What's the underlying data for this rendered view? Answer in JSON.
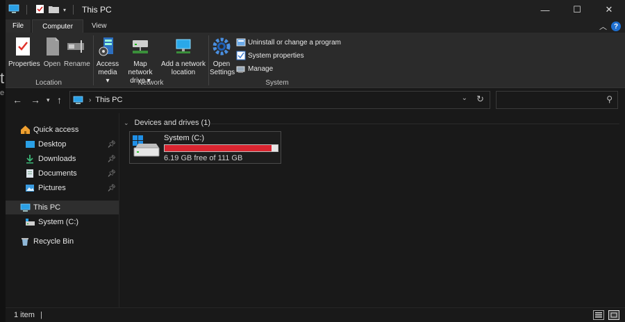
{
  "window": {
    "title": "This PC"
  },
  "controls": {
    "minimize": "—",
    "maximize": "☐",
    "close": "✕"
  },
  "tabs": {
    "file": "File",
    "computer": "Computer",
    "view": "View"
  },
  "ribbon": {
    "location": {
      "label": "Location",
      "properties": "Properties",
      "open": "Open",
      "rename": "Rename"
    },
    "network": {
      "label": "Network",
      "access_media": [
        "Access",
        "media ▾"
      ],
      "map_drive": [
        "Map network",
        "drive ▾"
      ],
      "add_location": [
        "Add a network",
        "location"
      ]
    },
    "system": {
      "label": "System",
      "open_settings": [
        "Open",
        "Settings"
      ],
      "uninstall": "Uninstall or change a program",
      "system_properties": "System properties",
      "manage": "Manage"
    }
  },
  "address": {
    "crumb": "This PC",
    "search_placeholder": ""
  },
  "nav": {
    "quick_access": "Quick access",
    "desktop": "Desktop",
    "downloads": "Downloads",
    "documents": "Documents",
    "pictures": "Pictures",
    "this_pc": "This PC",
    "system_drive": "System  (C:)",
    "recycle_bin": "Recycle Bin"
  },
  "content": {
    "group_header": "Devices and drives (1)",
    "drive": {
      "name": "System  (C:)",
      "free_text": "6.19 GB free of 111 GB",
      "used_fraction": 0.944
    }
  },
  "status": {
    "count": "1 item"
  },
  "colors": {
    "accent": "#1e6fd0",
    "bar_fill": "#da2530",
    "bg": "#191919"
  }
}
